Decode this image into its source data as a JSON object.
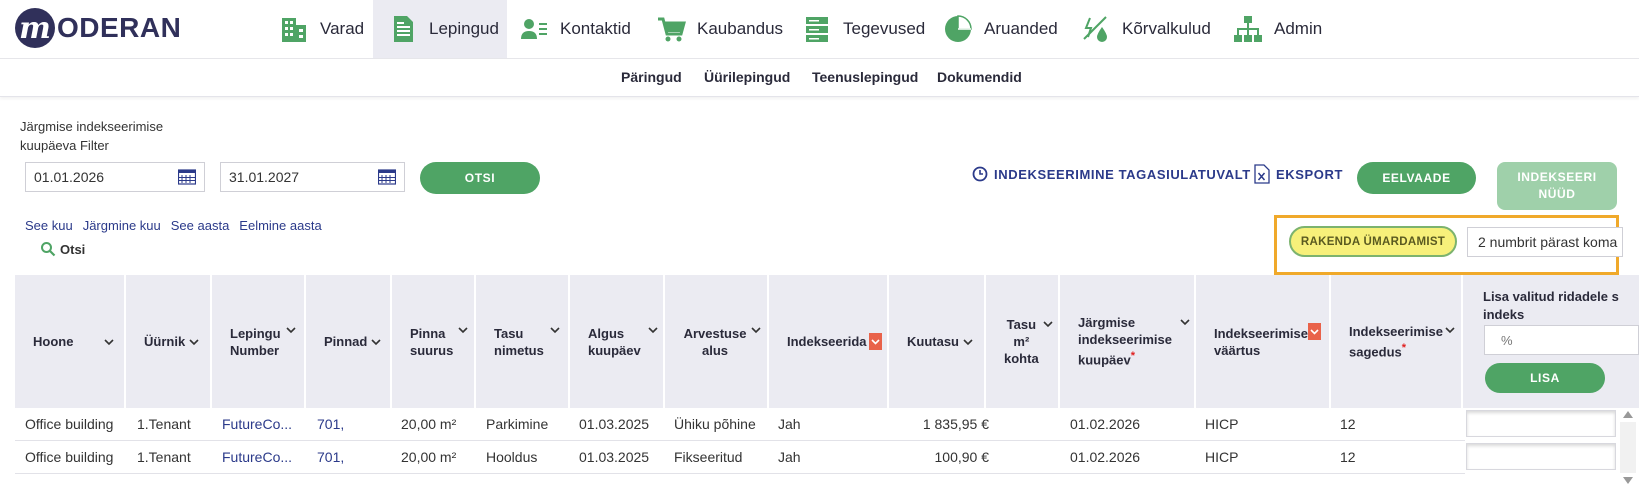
{
  "app": {
    "logo_letter": "m",
    "logo_text": "ODERAN"
  },
  "nav": {
    "items": [
      {
        "label": "Varad",
        "icon": "building-icon"
      },
      {
        "label": "Lepingud",
        "icon": "document-icon"
      },
      {
        "label": "Kontaktid",
        "icon": "contact-card-icon"
      },
      {
        "label": "Kaubandus",
        "icon": "cart-icon"
      },
      {
        "label": "Tegevused",
        "icon": "server-stack-icon"
      },
      {
        "label": "Aruanded",
        "icon": "pie-chart-icon"
      },
      {
        "label": "Kõrvalkulud",
        "icon": "energy-water-icon"
      },
      {
        "label": "Admin",
        "icon": "org-chart-icon"
      }
    ],
    "active": "Lepingud",
    "accent_color": "#4fa465"
  },
  "subnav": {
    "items": [
      "Päringud",
      "Üürilepingud",
      "Teenuslepingud",
      "Dokumendid"
    ]
  },
  "filter": {
    "label": "Järgmise indekseerimise kuupäeva Filter",
    "date_from": "01.01.2026",
    "date_to": "31.01.2027",
    "search_button": "OTSI",
    "quick_links": [
      "See kuu",
      "Järgmine kuu",
      "See aasta",
      "Eelmine aasta"
    ],
    "search_link": "Otsi"
  },
  "actions": {
    "retroactive": "INDEKSEERIMINE TAGASIULATUVALT",
    "export": "EKSPORT",
    "preview": "EELVAADE",
    "index_now": "INDEKSEERI NÜÜD",
    "apply_rounding": "RAKENDA ÜMARDAMIST",
    "rounding_value": "2 numbrit pärast koma"
  },
  "table": {
    "headers": {
      "building": "Hoone",
      "tenant": "Üürnik",
      "contract_number": "Lepingu Number",
      "areas": "Pinnad",
      "area_size": "Pinna suurus",
      "fee_name": "Tasu nimetus",
      "start_date": "Algus kuupäev",
      "calc_basis": "Arvestuse alus",
      "indexable": "Indekseerida",
      "monthly_fee": "Kuutasu",
      "fee_per_m2_1": "Tasu",
      "fee_per_m2_2": "m²",
      "fee_per_m2_3": "kohta",
      "next_index_date": "Järgmise indekseerimise kuupäev",
      "index_value": "Indekseerimise väärtus",
      "index_frequency": "Indekseerimise sagedus"
    },
    "panel": {
      "title": "Lisa valitud ridadele s indeks",
      "input_placeholder": "%",
      "add_button": "LISA"
    },
    "rows": [
      {
        "building": "Office building",
        "tenant": "1.Tenant",
        "contract": "FutureCo...",
        "areas": "701,",
        "size": "20,00 m²",
        "fee": "Parkimine",
        "start": "01.03.2025",
        "basis": "Ühiku põhine",
        "indexable": "Jah",
        "monthly": "1 835,95 €",
        "per_m2": "",
        "next_date": "01.02.2026",
        "index": "HICP",
        "freq": "12"
      },
      {
        "building": "Office building",
        "tenant": "1.Tenant",
        "contract": "FutureCo...",
        "areas": "701,",
        "size": "20,00 m²",
        "fee": "Hooldus",
        "start": "01.03.2025",
        "basis": "Fikseeritud",
        "indexable": "Jah",
        "monthly": "100,90 €",
        "per_m2": "",
        "next_date": "01.02.2026",
        "index": "HICP",
        "freq": "12"
      }
    ]
  }
}
